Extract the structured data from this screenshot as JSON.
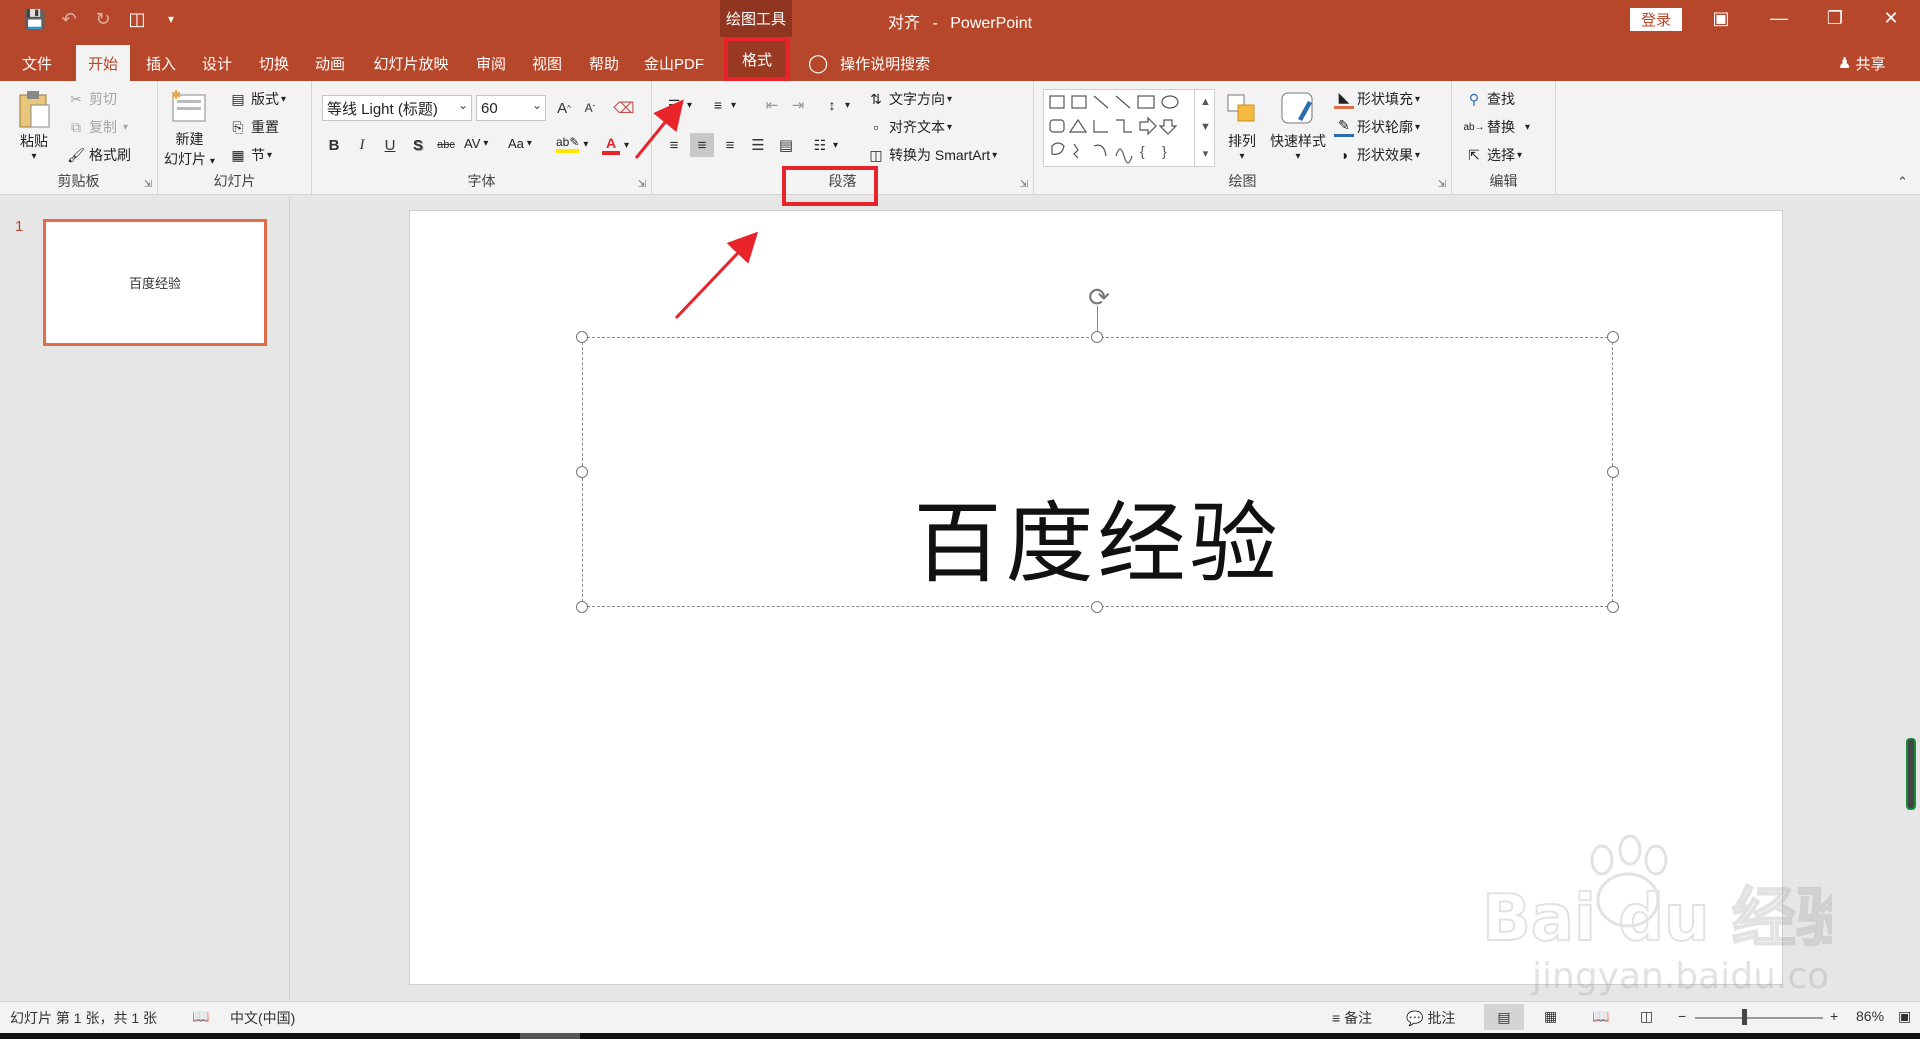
{
  "titlebar": {
    "context_group": "绘图工具",
    "doc_name": "对齐",
    "separator": "-",
    "app_name": "PowerPoint",
    "login": "登录"
  },
  "tabs": [
    "文件",
    "开始",
    "插入",
    "设计",
    "切换",
    "动画",
    "幻灯片放映",
    "审阅",
    "视图",
    "帮助",
    "金山PDF",
    "格式"
  ],
  "active_tab": "开始",
  "tell_me": "操作说明搜索",
  "share": "共享",
  "ribbon": {
    "clipboard": {
      "label": "剪贴板",
      "paste": "粘贴",
      "cut": "剪切",
      "copy": "复制",
      "format_painter": "格式刷"
    },
    "slides": {
      "label": "幻灯片",
      "new_slide_line1": "新建",
      "new_slide_line2": "幻灯片",
      "layout": "版式",
      "reset": "重置",
      "section": "节"
    },
    "font": {
      "label": "字体",
      "font_name": "等线 Light (标题)",
      "font_size": "60",
      "bold": "B",
      "italic": "I",
      "underline": "U",
      "shadow": "S",
      "strike": "abc",
      "spacing": "AV",
      "case": "Aa",
      "grow": "A",
      "shrink": "A",
      "font_color": "A"
    },
    "paragraph": {
      "label": "段落"
    },
    "text_tools": {
      "text_direction": "文字方向",
      "align_text": "对齐文本",
      "smartart": "转换为 SmartArt"
    },
    "drawing": {
      "label": "绘图",
      "arrange": "排列",
      "quick_styles": "快速样式",
      "shape_fill": "形状填充",
      "shape_outline": "形状轮廓",
      "shape_effects": "形状效果"
    },
    "editing": {
      "label": "编辑",
      "find": "查找",
      "replace": "替换",
      "select": "选择"
    }
  },
  "thumbnails": [
    {
      "number": "1",
      "text": "百度经验"
    }
  ],
  "slide": {
    "title": "百度经验"
  },
  "status": {
    "slide_info": "幻灯片 第 1 张，共 1 张",
    "language": "中文(中国)",
    "notes": "备注",
    "comments": "批注",
    "zoom_out": "−",
    "zoom_in": "+",
    "zoom": "86%"
  },
  "watermark": {
    "brand": "Bai du 经验",
    "url": "jingyan.baidu.com"
  },
  "colors": {
    "accent": "#b7472a",
    "annotation": "#e8232a"
  }
}
